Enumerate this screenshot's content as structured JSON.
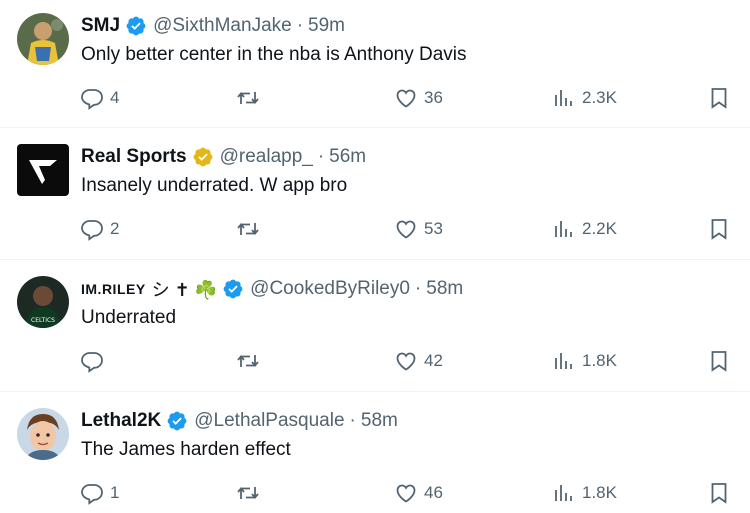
{
  "tweets": [
    {
      "display_name": "SMJ",
      "extra": "",
      "verified": "blue",
      "handle": "@SixthManJake",
      "separator": "·",
      "time": "59m",
      "text": "Only better center in the nba is Anthony Davis",
      "replies": "4",
      "retweets": "",
      "likes": "36",
      "views": "2.3K",
      "avatar": "jersey-photo-avatar"
    },
    {
      "display_name": "Real Sports",
      "extra": "",
      "verified": "gold",
      "handle": "@realapp_",
      "separator": "·",
      "time": "56m",
      "text": "Insanely underrated. W app bro",
      "replies": "2",
      "retweets": "",
      "likes": "53",
      "views": "2.2K",
      "avatar": "real-logo-avatar"
    },
    {
      "display_name": "IM.RILEY",
      "extra": "シ ✝ ☘️",
      "verified": "blue",
      "handle": "@CookedByRiley0",
      "separator": "·",
      "time": "58m",
      "text": "Underrated",
      "replies": "",
      "retweets": "",
      "likes": "42",
      "views": "1.8K",
      "avatar": "celtics-player-avatar"
    },
    {
      "display_name": "Lethal2K",
      "extra": "",
      "verified": "blue",
      "handle": "@LethalPasquale",
      "separator": "·",
      "time": "58m",
      "text": "The James harden effect",
      "replies": "1",
      "retweets": "",
      "likes": "46",
      "views": "1.8K",
      "avatar": "cartoon-face-avatar"
    }
  ],
  "colors": {
    "text": "#0f1419",
    "secondary": "#536471",
    "verified_blue": "#1d9bf0",
    "verified_gold": "#e2b719",
    "divider": "#eff3f4"
  }
}
